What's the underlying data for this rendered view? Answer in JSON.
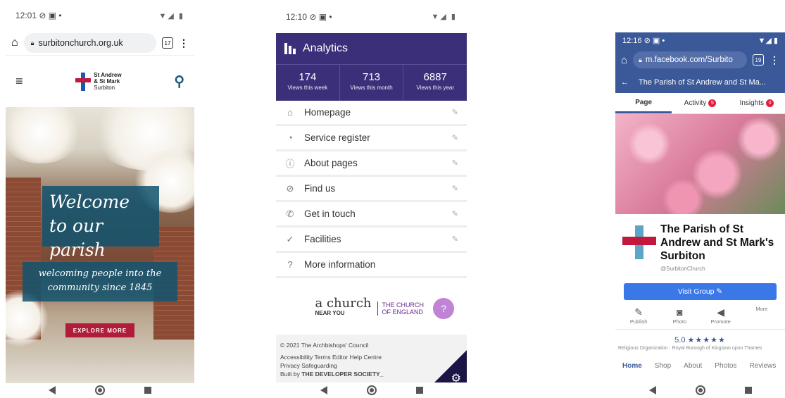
{
  "phone1": {
    "status_time": "12:01",
    "status_icons_left": "⊘ ▣ •",
    "status_icons_right": "▼◢ ▮",
    "url": "surbitonchurch.org.uk",
    "tab_count": "17",
    "logo_line1": "St Andrew",
    "logo_line2": "& St Mark",
    "logo_line3": "Surbiton",
    "hero_title": "Welcome to our parish",
    "hero_sub": "welcoming people into the community since 1845",
    "explore": "EXPLORE MORE"
  },
  "phone2": {
    "status_time": "12:10",
    "status_icons_left": "⊘ ▣ •",
    "status_icons_right": "▼◢ ▮",
    "header": "Analytics",
    "stats": [
      {
        "value": "174",
        "label": "Views this week"
      },
      {
        "value": "713",
        "label": "Views this month"
      },
      {
        "value": "6887",
        "label": "Views this year"
      }
    ],
    "menu": [
      {
        "label": "Homepage",
        "icon": "⌂"
      },
      {
        "label": "Service register",
        "icon": "◔"
      },
      {
        "label": "About pages",
        "icon": "ⓘ"
      },
      {
        "label": "Find us",
        "icon": "⊘"
      },
      {
        "label": "Get in touch",
        "icon": "✆"
      },
      {
        "label": "Facilities",
        "icon": "✓"
      },
      {
        "label": "More information",
        "icon": "?"
      }
    ],
    "acny_a": "a church",
    "acny_b": "NEAR YOU",
    "coe": "THE CHURCH OF ENGLAND",
    "copyright": "© 2021 The Archbishops' Council",
    "links1": "Accessibility  Terms  Editor Help Centre",
    "links2": "Privacy  Safeguarding",
    "built_prefix": "Built by ",
    "built_by": "THE DEVELOPER SOCIETY_"
  },
  "phone3": {
    "status_time": "12:16",
    "status_icons_left": "⊘ ▣ •",
    "status_icons_right": "▼◢ ▮",
    "url": "m.facebook.com/Surbito",
    "tab_count": "19",
    "title": "The Parish of St Andrew and St Ma...",
    "tabs": [
      {
        "label": "Page",
        "badge": ""
      },
      {
        "label": "Activity",
        "badge": "5"
      },
      {
        "label": "Insights",
        "badge": "0"
      }
    ],
    "page_name": "The Parish of St Andrew and St Mark's Surbiton",
    "handle": "@SurbitonChurch",
    "visit": "Visit Group ✎",
    "actions": [
      {
        "icon": "✎",
        "label": "Publish"
      },
      {
        "icon": "◙",
        "label": "Photo"
      },
      {
        "icon": "◀",
        "label": "Promote"
      },
      {
        "icon": "",
        "label": "More"
      }
    ],
    "rating": "5.0",
    "stars": "★★★★★",
    "category": "Religious Organization · Royal Borough of Kingston upon Thames",
    "bottom_tabs": [
      "Home",
      "Shop",
      "About",
      "Photos",
      "Reviews"
    ]
  }
}
